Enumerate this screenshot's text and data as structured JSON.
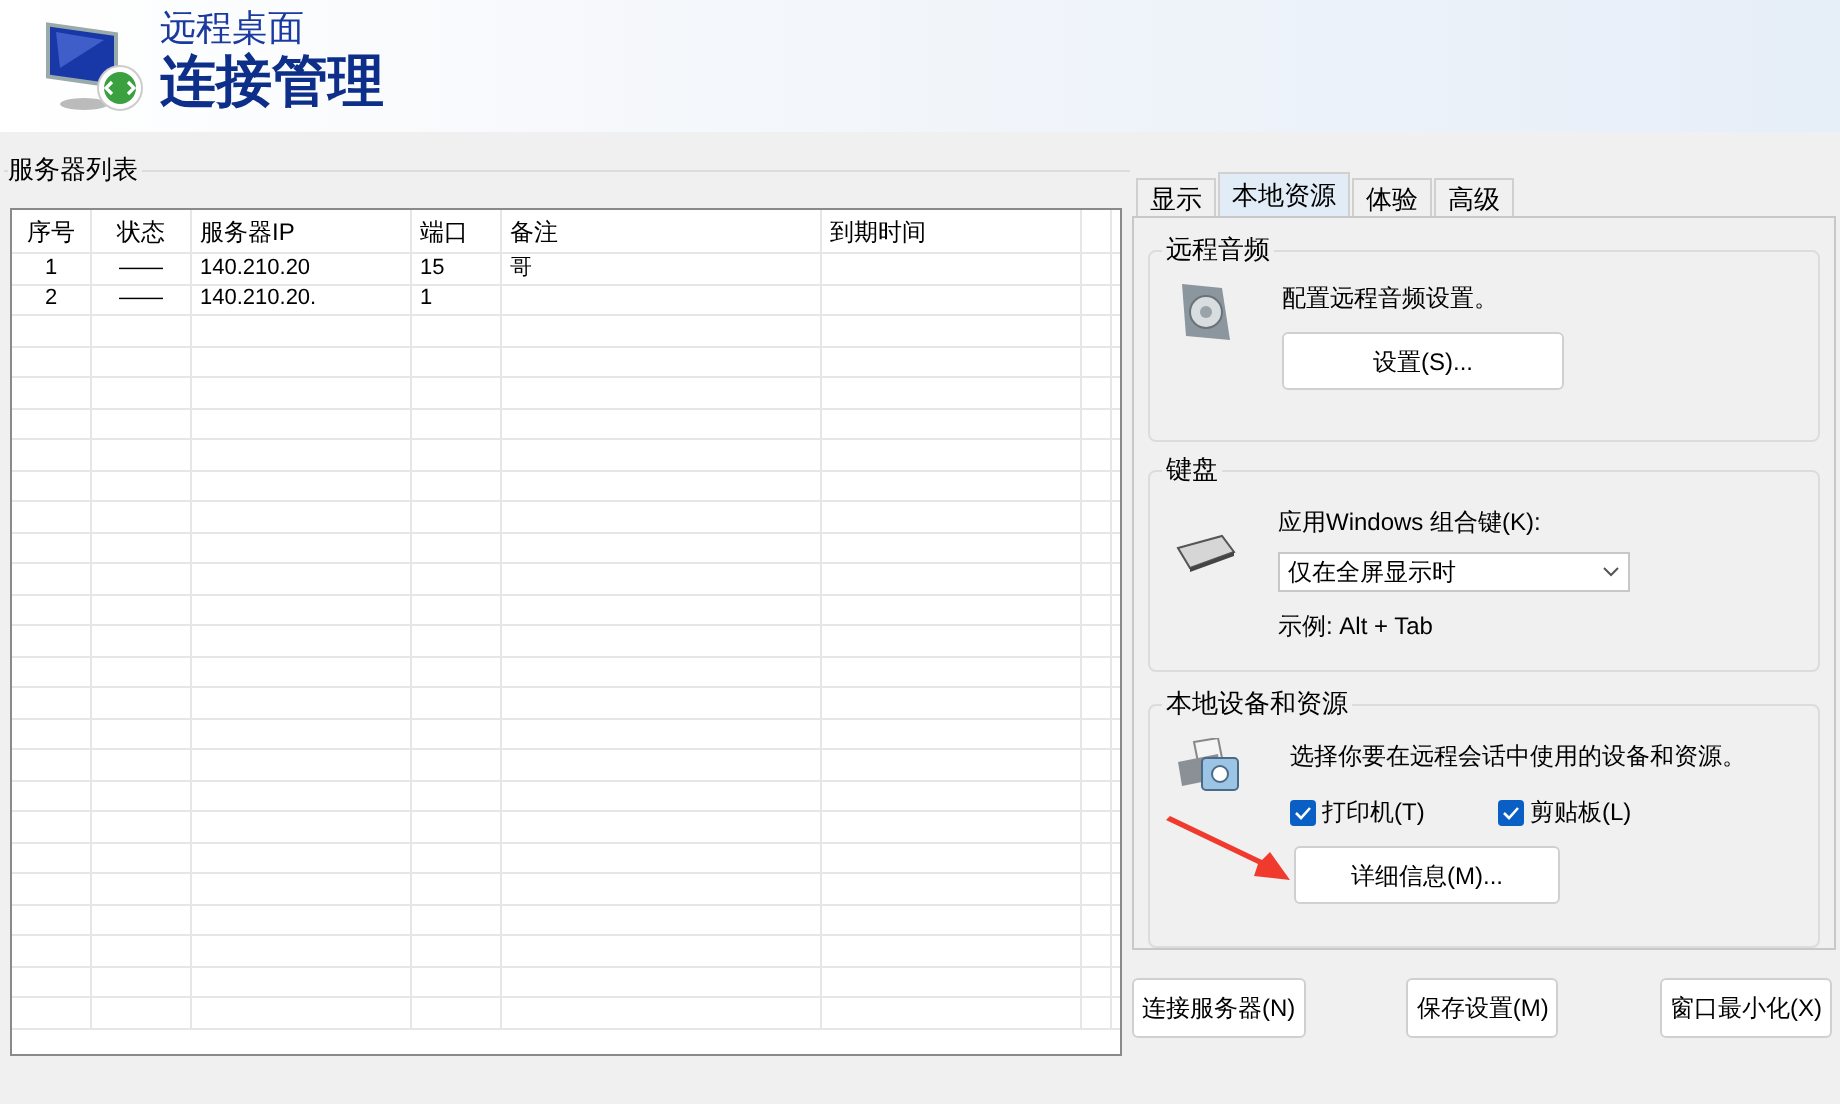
{
  "header": {
    "subtitle": "远程桌面",
    "title": "连接管理"
  },
  "server_list": {
    "title": "服务器列表",
    "columns": [
      "序号",
      "状态",
      "服务器IP",
      "端口",
      "备注",
      "到期时间"
    ],
    "rows": [
      {
        "index": "1",
        "status": "——",
        "ip": "140.210.20",
        "port": "15",
        "note": "哥"
      },
      {
        "index": "2",
        "status": "——",
        "ip": "140.210.20.",
        "port": "1"
      }
    ]
  },
  "tabs": [
    {
      "label": "显示",
      "selected": false
    },
    {
      "label": "本地资源",
      "selected": true
    },
    {
      "label": "体验",
      "selected": false
    },
    {
      "label": "高级",
      "selected": false
    }
  ],
  "audio": {
    "title": "远程音频",
    "description": "配置远程音频设置。",
    "button": "设置(S)..."
  },
  "keyboard": {
    "title": "键盘",
    "label": "应用Windows 组合键(K):",
    "select_value": "仅在全屏显示时",
    "example": "示例: Alt + Tab"
  },
  "local": {
    "title": "本地设备和资源",
    "description": "选择你要在远程会话中使用的设备和资源。",
    "checkboxes": [
      {
        "label": "打印机(T)",
        "checked": true
      },
      {
        "label": "剪贴板(L)",
        "checked": true
      }
    ],
    "button": "详细信息(M)..."
  },
  "buttons": [
    "连接服务器(N)",
    "保存设置(M)",
    "窗口最小化(X)"
  ]
}
